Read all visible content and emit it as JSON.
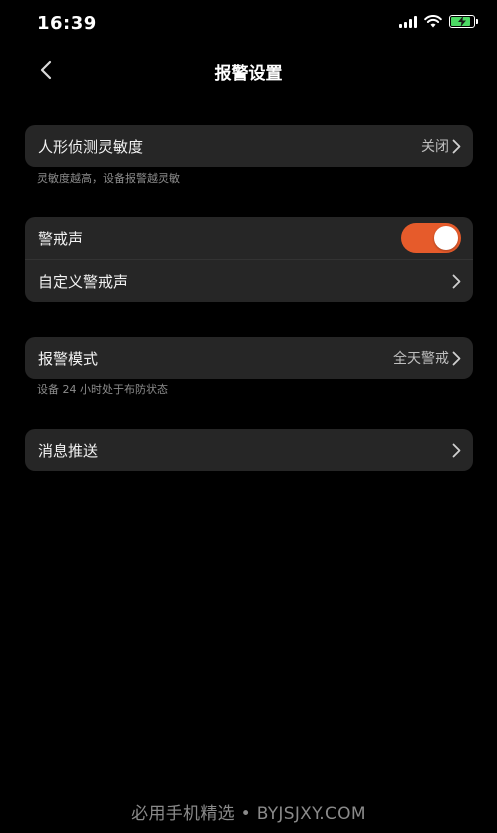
{
  "status_bar": {
    "time": "16:39"
  },
  "nav": {
    "title": "报警设置"
  },
  "sensitivity": {
    "label": "人形侦测灵敏度",
    "value": "关闭",
    "hint": "灵敏度越高，设备报警越灵敏"
  },
  "alarm_sound": {
    "toggle_label": "警戒声",
    "toggle_on": true,
    "custom_label": "自定义警戒声"
  },
  "alarm_mode": {
    "label": "报警模式",
    "value": "全天警戒",
    "hint": "设备 24 小时处于布防状态"
  },
  "push": {
    "label": "消息推送"
  },
  "watermark": {
    "text": "必用手机精选 • BYJSJXY.COM"
  },
  "colors": {
    "background": "#000000",
    "card": "#262626",
    "accent_toggle": "#e65b2b",
    "battery": "#4cd964"
  }
}
